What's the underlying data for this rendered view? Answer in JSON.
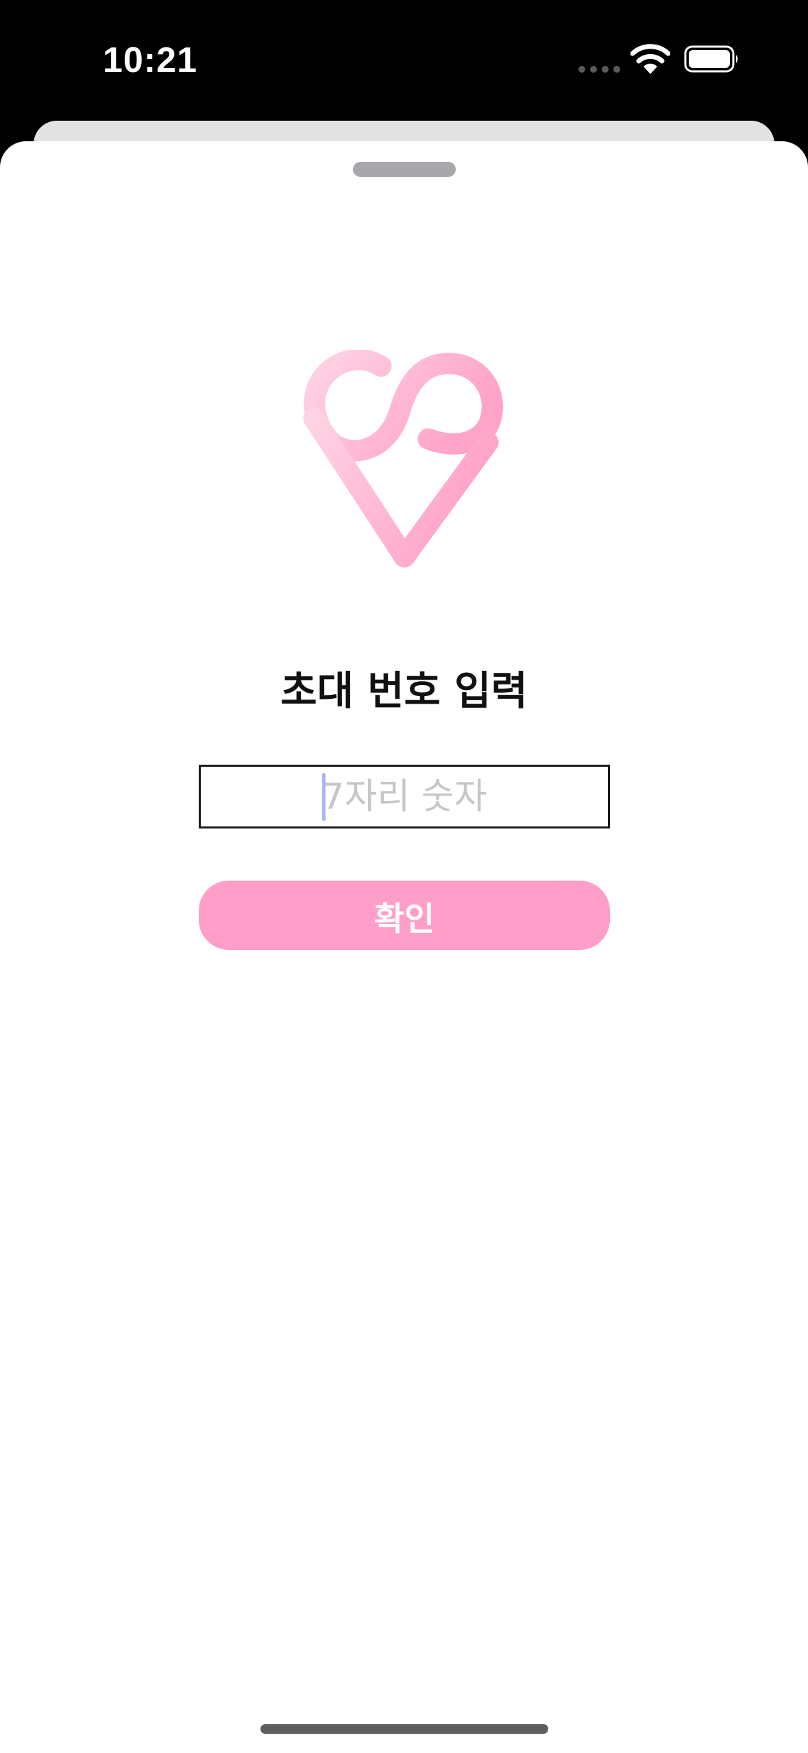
{
  "status_bar": {
    "time": "10:21",
    "icons": [
      "signal-dots-icon",
      "wifi-icon",
      "battery-icon"
    ]
  },
  "logo": {
    "icon": "heart-infinity-logo",
    "colors": [
      "#ffd3e4",
      "#ffa6c9"
    ]
  },
  "invite": {
    "title": "초대 번호 입력",
    "input": {
      "value": "",
      "placeholder": "7자리 숫자"
    },
    "confirm_label": "확인"
  },
  "colors": {
    "accent": "#ff9ec8",
    "caret": "#a7b6f0",
    "placeholder": "#c6c6c8"
  }
}
